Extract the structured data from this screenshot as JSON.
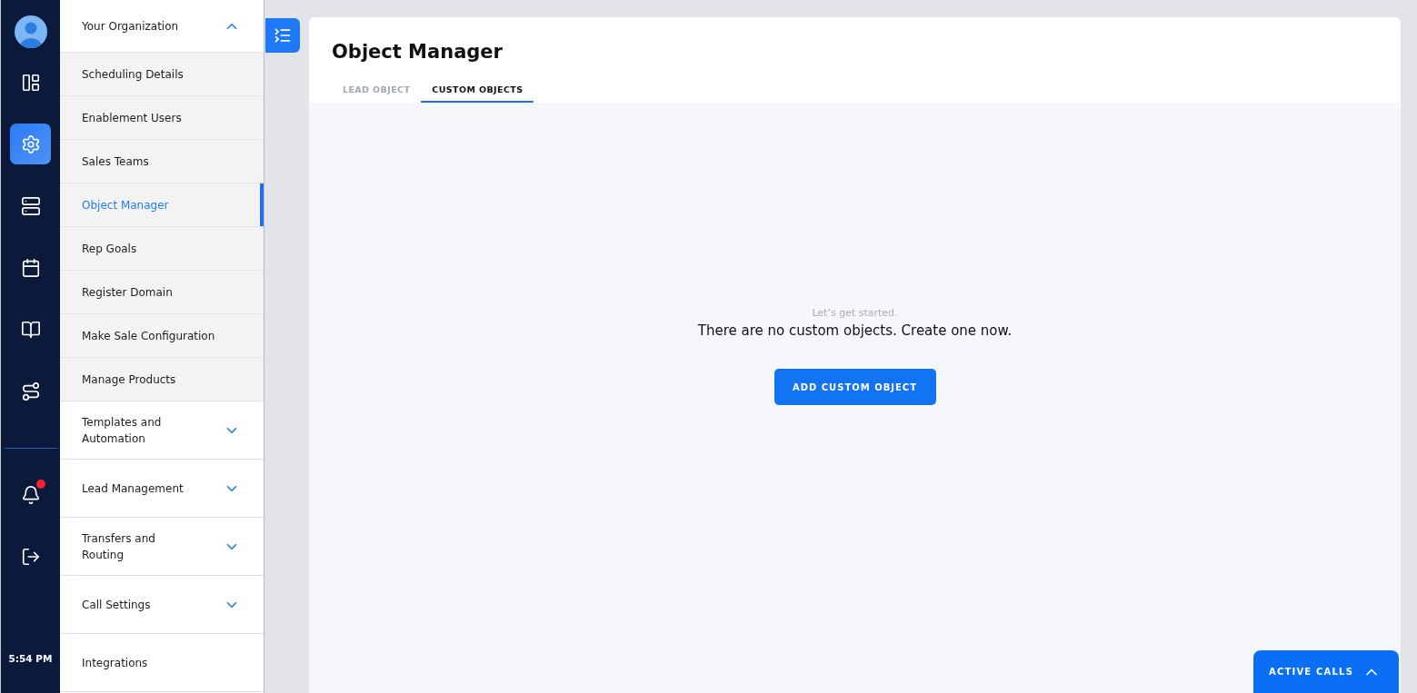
{
  "rail": {
    "nav": [
      {
        "kind": "layout",
        "selected": false
      },
      {
        "kind": "settings",
        "selected": true
      },
      {
        "kind": "server",
        "selected": false
      },
      {
        "kind": "calendar",
        "selected": false
      },
      {
        "kind": "book",
        "selected": false
      },
      {
        "kind": "route",
        "selected": false
      }
    ],
    "notifications": {
      "unread": true
    },
    "time": "5:54 PM"
  },
  "menu": [
    {
      "kind": "group",
      "label": "Your Organization",
      "expanded": true,
      "children": [
        {
          "label": "Scheduling Details",
          "selected": false
        },
        {
          "label": "Enablement Users",
          "selected": false
        },
        {
          "label": "Sales Teams",
          "selected": false
        },
        {
          "label": "Object Manager",
          "selected": true
        },
        {
          "label": "Rep Goals",
          "selected": false
        },
        {
          "label": "Register Domain",
          "selected": false
        },
        {
          "label": "Make Sale Configuration",
          "selected": false
        },
        {
          "label": "Manage Products",
          "selected": false
        }
      ]
    },
    {
      "kind": "group",
      "label": "Templates and Automation",
      "expanded": false
    },
    {
      "kind": "group",
      "label": "Lead Management",
      "expanded": false
    },
    {
      "kind": "group",
      "label": "Transfers and Routing",
      "expanded": false
    },
    {
      "kind": "group",
      "label": "Call Settings",
      "expanded": false
    },
    {
      "kind": "link",
      "label": "Integrations"
    }
  ],
  "page": {
    "title": "Object Manager",
    "tabs": [
      {
        "label": "LEAD OBJECT",
        "selected": false
      },
      {
        "label": "CUSTOM OBJECTS",
        "selected": true
      }
    ],
    "empty": {
      "kicker": "Let’s get started.",
      "message": "There are no custom objects. Create one now.",
      "button": "ADD CUSTOM OBJECT"
    }
  },
  "active_calls": {
    "label": "ACTIVE CALLS",
    "expanded": false
  }
}
